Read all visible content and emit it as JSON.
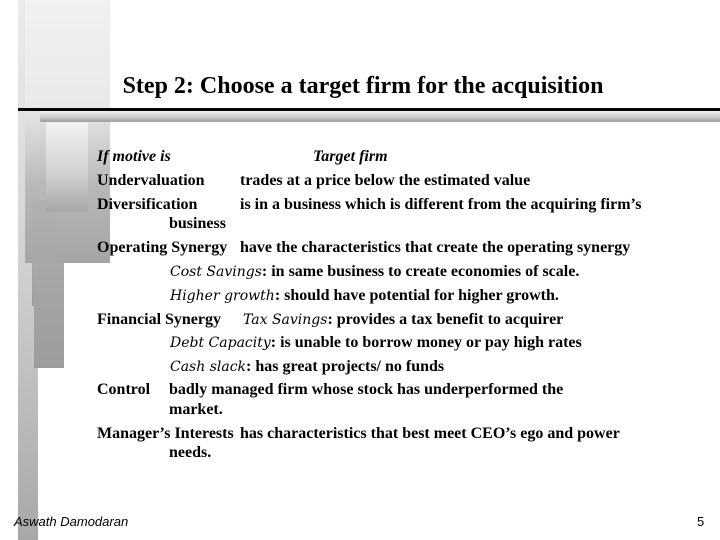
{
  "slide": {
    "title": "Step 2: Choose a target firm for the acquisition",
    "header": {
      "col1": "If motive is",
      "col2": "Target firm"
    },
    "rows": {
      "undervaluation": {
        "label": "Undervaluation",
        "text": "trades at a price below the estimated value"
      },
      "diversification": {
        "label": "Diversification",
        "text": "is in a business which is different from the acquiring firm’s",
        "cont": "business"
      },
      "operating": {
        "label": "Operating Synergy",
        "text": "have the characteristics that create the operating synergy",
        "sub": [
          {
            "term": "Cost Savings",
            "text": ": in same business to create economies of scale."
          },
          {
            "term": "Higher growth",
            "text": ": should have potential for higher growth."
          }
        ]
      },
      "financial": {
        "label": "Financial Synergy",
        "sub": [
          {
            "term": "Tax Savings",
            "text": ": provides a tax benefit to acquirer"
          },
          {
            "term": "Debt Capacity",
            "text": ": is unable to borrow money or pay high rates"
          },
          {
            "term": "Cash slack",
            "text": ": has great projects/ no funds"
          }
        ]
      },
      "control": {
        "label": "Control",
        "text": "badly managed firm whose stock has underperformed the",
        "cont": "market."
      },
      "manager": {
        "label": "Manager’s Interests",
        "text": "has characteristics that best meet CEO’s ego and power",
        "cont": "needs."
      }
    }
  },
  "footer": {
    "author": "Aswath Damodaran",
    "page_number": "5"
  }
}
